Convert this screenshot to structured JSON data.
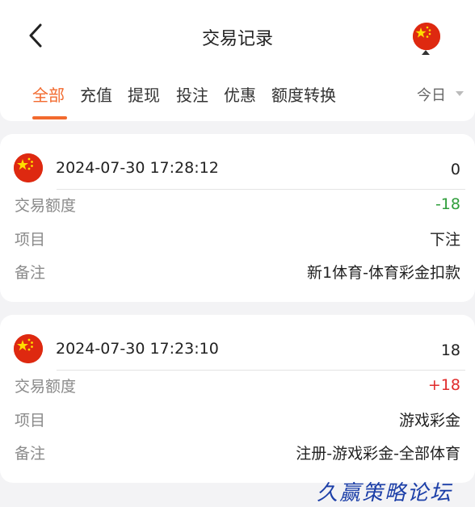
{
  "header": {
    "title": "交易记录"
  },
  "tabs": [
    {
      "label": "全部",
      "active": true
    },
    {
      "label": "充值",
      "active": false
    },
    {
      "label": "提现",
      "active": false
    },
    {
      "label": "投注",
      "active": false
    },
    {
      "label": "优惠",
      "active": false
    },
    {
      "label": "额度转换",
      "active": false
    }
  ],
  "filter": {
    "period": "今日"
  },
  "colors": {
    "accent": "#f26a2e",
    "negative": "#2f9e3b",
    "positive": "#e02b2b",
    "flag_red": "#de2910",
    "flag_star": "#ffde00"
  },
  "records": [
    {
      "time": "2024-07-30 17:28:12",
      "number": "0",
      "amount_label": "交易额度",
      "amount": "-18",
      "item_label": "项目",
      "item": "下注",
      "note_label": "备注",
      "note": "新1体育-体育彩金扣款"
    },
    {
      "time": "2024-07-30 17:23:10",
      "number": "18",
      "amount_label": "交易额度",
      "amount": "+18",
      "item_label": "项目",
      "item": "游戏彩金",
      "note_label": "备注",
      "note": "注册-游戏彩金-全部体育"
    }
  ],
  "watermark": "久赢策略论坛"
}
